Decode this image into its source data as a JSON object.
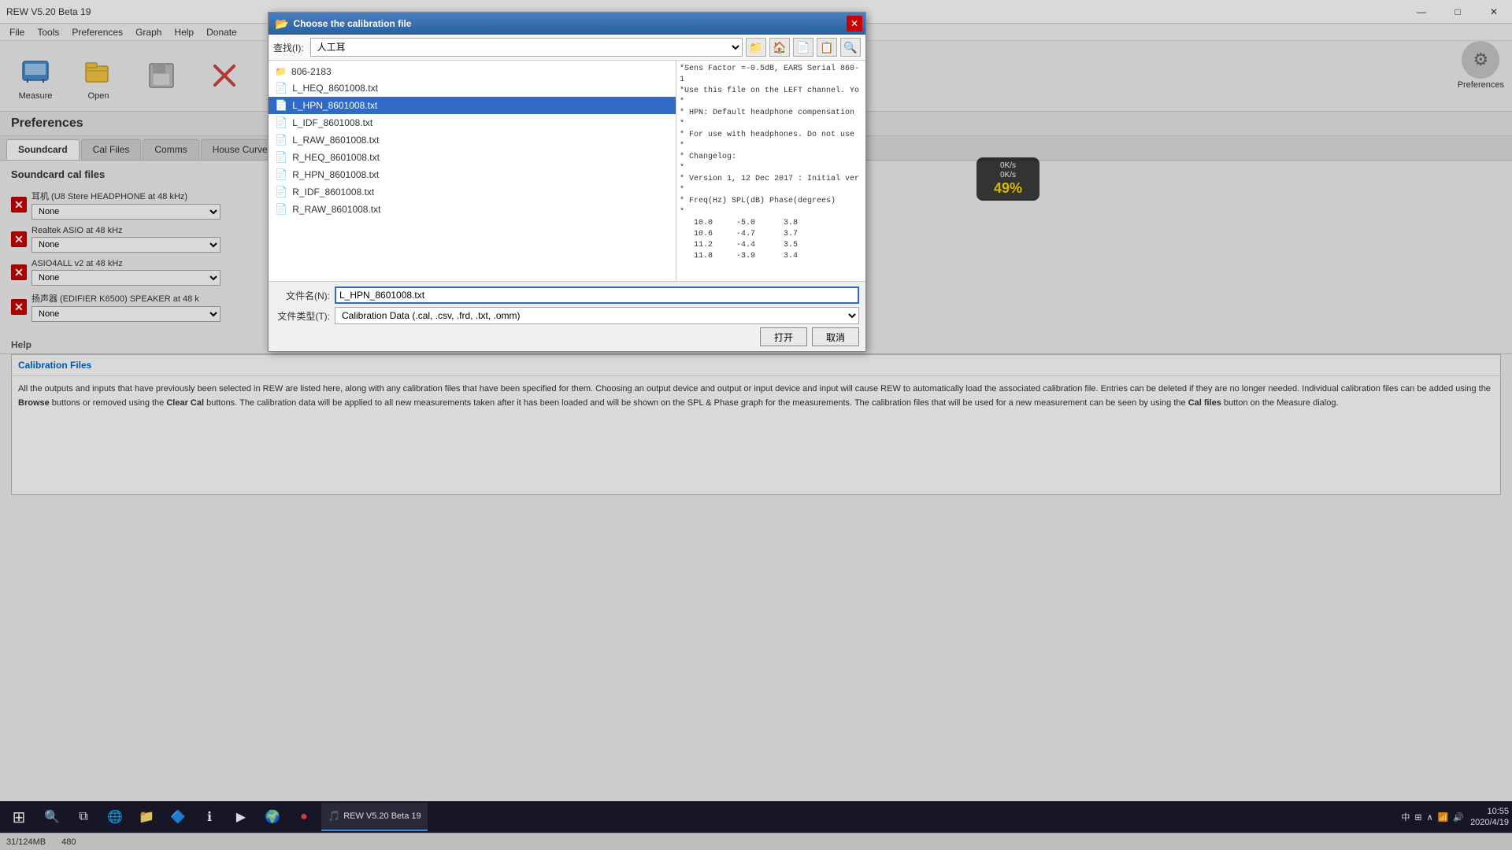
{
  "app": {
    "title": "REW V5.20 Beta 19",
    "version": "V5.20 Beta 19"
  },
  "title_bar": {
    "minimize_label": "—",
    "maximize_label": "□",
    "close_label": "✕"
  },
  "menu": {
    "items": [
      "File",
      "Tools",
      "Preferences",
      "Graph",
      "Help",
      "Donate"
    ]
  },
  "toolbar": {
    "measure_label": "Measure",
    "open_label": "Open",
    "preferences_label": "Preferences",
    "preferences_label_tr": "Preferences"
  },
  "preferences": {
    "title": "Preferences",
    "tabs": [
      "Soundcard",
      "Cal Files",
      "Comms",
      "House Curve"
    ],
    "active_tab_index": 1
  },
  "cal_files": {
    "section_label": "Soundcard cal files",
    "rows": [
      {
        "device": "耳机 (U8 Stere HEADPHONE at 48 kHz)",
        "value": "None"
      },
      {
        "device": "Realtek ASIO at 48 kHz",
        "value": "None"
      },
      {
        "device": "ASIO4ALL v2 at 48 kHz",
        "value": "None"
      },
      {
        "device": "扬声器 (EDIFIER K6500) SPEAKER at 48 k",
        "value": "None"
      }
    ]
  },
  "help": {
    "section_label": "Help",
    "title": "Calibration Files",
    "content_parts": [
      "All the outputs and inputs that have previously been selected in REW are listed here, along with any calibration files that have been specified for them. Choosing an output device and output or input device and input will cause REW to automatically load the associated calibration file. Entries can be deleted if they are no longer needed. Individual calibration files can be added using the ",
      "Browse",
      " buttons or removed using the ",
      "Clear Cal",
      " buttons. The calibration data will be applied to all new measurements taken after it has been loaded and will be shown on the SPL & Phase graph for the measurements. The calibration files that will be used for a new measurement can be seen by using the ",
      "Cal files",
      " button on the Measure dialog."
    ]
  },
  "status_bar": {
    "memory": "31/124MB",
    "rate": "480"
  },
  "taskbar": {
    "time": "10:55",
    "date": "2020/4/19",
    "app_label": "REW V5.20 Beta 19"
  },
  "dialog": {
    "title": "Choose the calibration file",
    "toolbar": {
      "look_in_label": "查找(I):",
      "path_value": "人工耳",
      "nav_buttons": [
        "📁",
        "🏠",
        "📄",
        "📋",
        "🔍"
      ]
    },
    "folder": {
      "name": "806-2183"
    },
    "files": [
      "L_HEQ_8601008.txt",
      "L_HPN_8601008.txt",
      "L_IDF_8601008.txt",
      "L_RAW_8601008.txt",
      "R_HEQ_8601008.txt",
      "R_HPN_8601008.txt",
      "R_IDF_8601008.txt",
      "R_RAW_8601008.txt"
    ],
    "selected_file": "L_HPN_8601008.txt",
    "preview_lines": [
      "*Sens Factor =-0.5dB, EARS Serial 860-1",
      "*Use this file on the LEFT channel. Yo",
      "*",
      "* HPN: Default headphone compensation",
      "*",
      "* For use with headphones. Do not use",
      "*",
      "* Changelog:",
      "*",
      "* Version 1, 12 Dec 2017 : Initial ver",
      "*",
      "* Freq(Hz)  SPL(dB)  Phase(degrees)",
      "*",
      "   10.0     -5.0      3.8",
      "   10.6     -4.7      3.7",
      "   11.2     -4.4      3.5",
      "   11.8     -3.9      3.4"
    ],
    "filename_label": "文件名(N):",
    "filename_value": "L_HPN_8601008.txt",
    "filetype_label": "文件类型(T):",
    "filetype_value": "Calibration Data (.cal, .csv, .frd, .txt, .omm)",
    "open_btn": "打开",
    "cancel_btn": "取消"
  },
  "cpu_widget": {
    "upload": "0K/s",
    "download": "0K/s",
    "cpu_pct": "49%"
  }
}
